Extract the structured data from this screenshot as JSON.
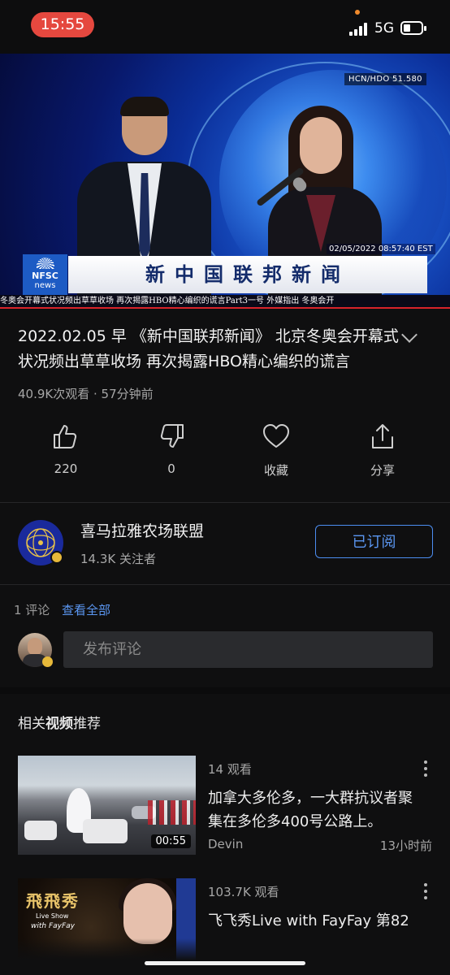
{
  "status_bar": {
    "time": "15:55",
    "network": "5G"
  },
  "video": {
    "channel_tag": "HCN/HDO   51.580",
    "timestamp": "02/05/2022 08:57:40 EST",
    "logo_line1": "NFSC",
    "logo_line2": "news",
    "banner": "新中国联邦新闻",
    "ticker": "冬奥会开幕式状况频出草草收场      再次揭露HBO精心编织的谎言Part3一号      外媒指出 冬奥会开"
  },
  "title": "2022.02.05 早 《新中国联邦新闻》 北京冬奥会开幕式状况频出草草收场 再次揭露HBO精心编织的谎言",
  "meta": "40.9K次观看 · 57分钟前",
  "actions": {
    "like_count": "220",
    "dislike_count": "0",
    "favorite_label": "收藏",
    "share_label": "分享"
  },
  "channel": {
    "name": "喜马拉雅农场联盟",
    "subscribers": "14.3K 关注者",
    "subscribe_label": "已订阅"
  },
  "comments": {
    "count": "1 评论",
    "see_all": "查看全部",
    "placeholder": "发布评论"
  },
  "related": {
    "heading_prefix": "相关",
    "heading_bold": "视频",
    "heading_suffix": "推荐",
    "items": [
      {
        "views": "14 观看",
        "title": "加拿大多伦多，一大群抗议者聚集在多伦多400号公路上。",
        "author": "Devin",
        "age": "13小时前",
        "duration": "00:55"
      },
      {
        "views": "103.7K 观看",
        "title": "飞飞秀Live with FayFay 第82",
        "thumb_brand": "飛飛秀",
        "thumb_sub1": "Live Show",
        "thumb_sub2": "with FayFay"
      }
    ]
  },
  "colors": {
    "accent": "#5b97f2",
    "time_pill": "#e5483f",
    "background": "#0f0f10"
  }
}
